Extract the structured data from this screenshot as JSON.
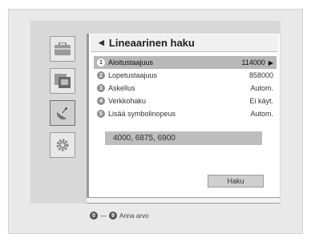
{
  "panel": {
    "title": "Lineaarinen haku",
    "items": [
      {
        "num": "1",
        "label": "Aloitustaajuus",
        "value": "114000",
        "selected": true
      },
      {
        "num": "2",
        "label": "Lopetustaajuus",
        "value": "858000",
        "selected": false
      },
      {
        "num": "3",
        "label": "Askellus",
        "value": "Autom.",
        "selected": false
      },
      {
        "num": "4",
        "label": "Verkkohaku",
        "value": "Ei käyt.",
        "selected": false
      },
      {
        "num": "5",
        "label": "Lisää symbolinopeus",
        "value": "Autom.",
        "selected": false
      }
    ],
    "symbol_rates": "4000, 6875, 6900",
    "search_button": "Haku"
  },
  "sidebar": {
    "icons": [
      "briefcase-icon",
      "folder-icon",
      "satellite-dish-icon",
      "settings-gear-icon"
    ],
    "active_index": 2
  },
  "hint": {
    "key_from": "0",
    "key_to": "9",
    "text": "Anna arvo"
  }
}
